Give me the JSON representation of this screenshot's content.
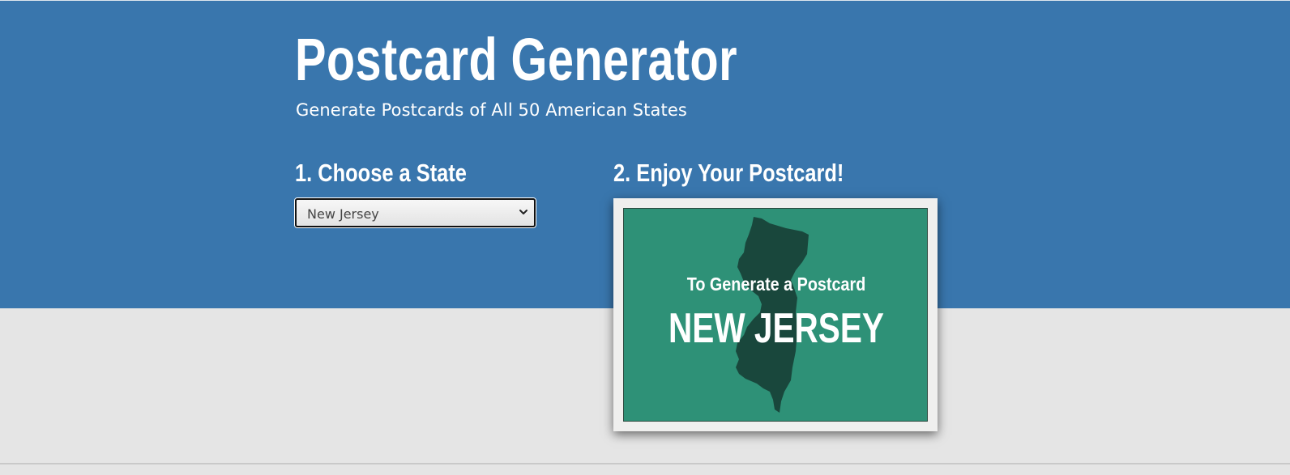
{
  "header": {
    "title": "Postcard Generator",
    "subtitle": "Generate Postcards of All 50 American States"
  },
  "steps": {
    "choose": {
      "heading": "1. Choose a State",
      "selected_state": "New Jersey"
    },
    "enjoy": {
      "heading": "2. Enjoy Your Postcard!"
    }
  },
  "postcard": {
    "tagline": "To Generate a Postcard",
    "state_name": "NEW JERSEY",
    "state_shape_icon": "new-jersey-silhouette-icon"
  },
  "colors": {
    "hero_background": "#3976ad",
    "page_background": "#e5e5e5",
    "postcard_green": "#2e9177",
    "state_silhouette": "#19473c"
  }
}
